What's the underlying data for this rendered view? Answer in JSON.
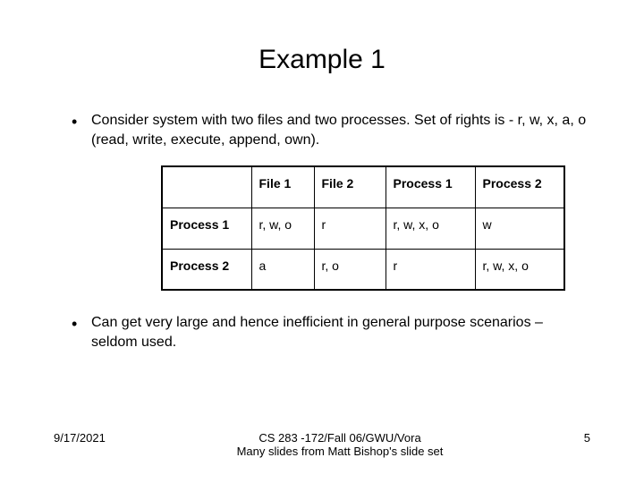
{
  "title": "Example 1",
  "bullets": {
    "b1": "Consider system with two files and two processes. Set of rights is - r, w, x, a, o (read, write, execute, append, own).",
    "b2": "Can get very large and hence inefficient in general purpose scenarios – seldom used."
  },
  "table": {
    "headers": {
      "blank": "",
      "f1": "File 1",
      "f2": "File 2",
      "p1": "Process 1",
      "p2": "Process 2"
    },
    "rows": [
      {
        "label": "Process 1",
        "f1": "r, w, o",
        "f2": "r",
        "p1": "r, w, x, o",
        "p2": "w"
      },
      {
        "label": "Process 2",
        "f1": "a",
        "f2": "r, o",
        "p1": "r",
        "p2": "r, w, x, o"
      }
    ]
  },
  "footer": {
    "date": "9/17/2021",
    "center_line1": "CS 283 -172/Fall 06/GWU/Vora",
    "center_line2": "Many slides from Matt Bishop's slide set",
    "page": "5"
  }
}
